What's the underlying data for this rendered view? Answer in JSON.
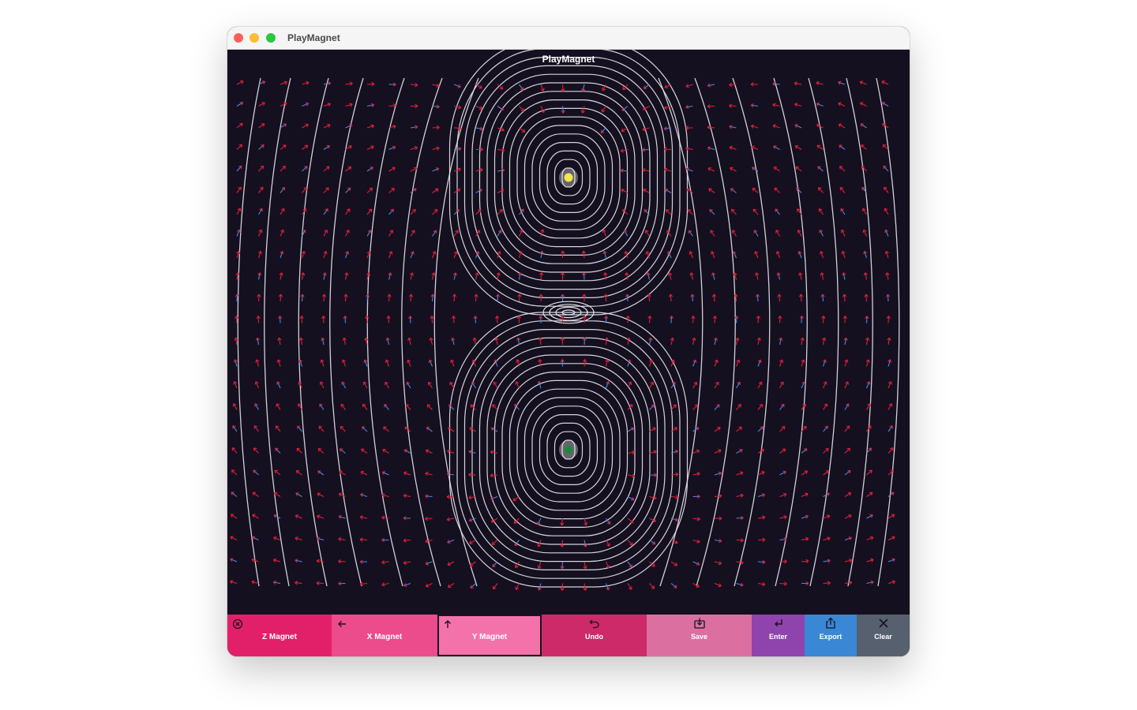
{
  "window": {
    "title": "PlayMagnet"
  },
  "canvas": {
    "heading": "PlayMagnet",
    "background": "#15101f",
    "field_line_color": "#e6e6ec",
    "arrow_color_primary": "#e0203a",
    "arrow_color_secondary": "#4a86e8",
    "magnets": [
      {
        "name": "yellow-pole",
        "color": "#f6e64a"
      },
      {
        "name": "green-pole",
        "color": "#1a8a3a"
      }
    ]
  },
  "toolbar": {
    "items": [
      {
        "key": "z-magnet",
        "label": "Z Magnet",
        "icon": "circle-x-icon",
        "color": "#e2206a",
        "selected": false
      },
      {
        "key": "x-magnet",
        "label": "X Magnet",
        "icon": "arrow-left-icon",
        "color": "#ec4b8c",
        "selected": false
      },
      {
        "key": "y-magnet",
        "label": "Y Magnet",
        "icon": "arrow-up-icon",
        "color": "#f472aa",
        "selected": true
      },
      {
        "key": "undo",
        "label": "Undo",
        "icon": "undo-icon",
        "color": "#cc2a68"
      },
      {
        "key": "save",
        "label": "Save",
        "icon": "save-icon",
        "color": "#db70a0"
      },
      {
        "key": "enter",
        "label": "Enter",
        "icon": "enter-icon",
        "color": "#8f44ad"
      },
      {
        "key": "export",
        "label": "Export",
        "icon": "export-icon",
        "color": "#3a87d6"
      },
      {
        "key": "clear",
        "label": "Clear",
        "icon": "close-icon",
        "color": "#56606e"
      }
    ]
  }
}
